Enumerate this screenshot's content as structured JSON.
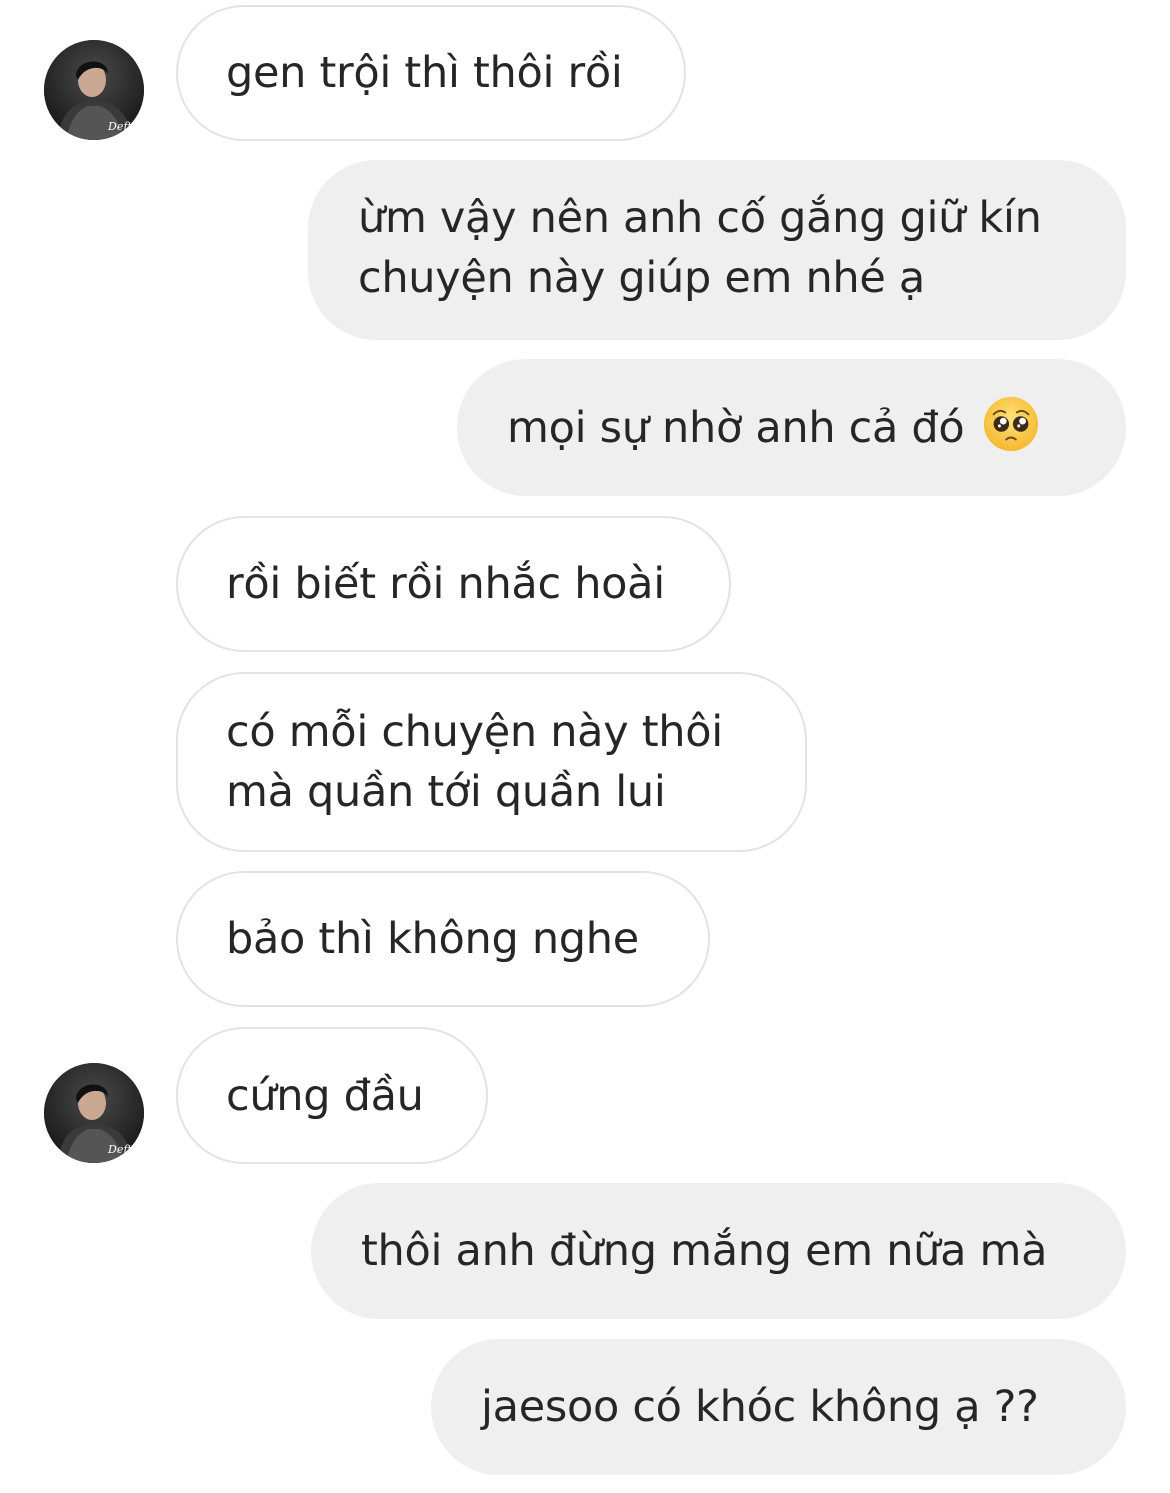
{
  "chat": {
    "avatar": {
      "label": "Deft"
    },
    "messages": [
      {
        "sender": "them",
        "lines": [
          "gen trội thì thôi rồi"
        ]
      },
      {
        "sender": "me",
        "lines": [
          "ừm vậy nên anh cố gắng giữ kín",
          "chuyện này giúp em nhé ạ"
        ]
      },
      {
        "sender": "me",
        "lines": [
          "mọi sự nhờ anh cả đó"
        ],
        "emoji": "pleading-face-emoji"
      },
      {
        "sender": "them",
        "lines": [
          "rồi biết rồi nhắc hoài"
        ]
      },
      {
        "sender": "them",
        "lines": [
          "có mỗi chuyện này thôi",
          "mà quần tới quần lui"
        ]
      },
      {
        "sender": "them",
        "lines": [
          "bảo thì không nghe"
        ]
      },
      {
        "sender": "them",
        "lines": [
          "cứng đầu"
        ]
      },
      {
        "sender": "me",
        "lines": [
          "thôi anh đừng mắng em nữa mà"
        ]
      },
      {
        "sender": "me",
        "lines": [
          "jaesoo có khóc không ạ ??"
        ]
      }
    ]
  },
  "colors": {
    "incoming_bg": "#ffffff",
    "incoming_border": "#e3e3e3",
    "outgoing_bg": "#efefef",
    "text": "#262626"
  }
}
